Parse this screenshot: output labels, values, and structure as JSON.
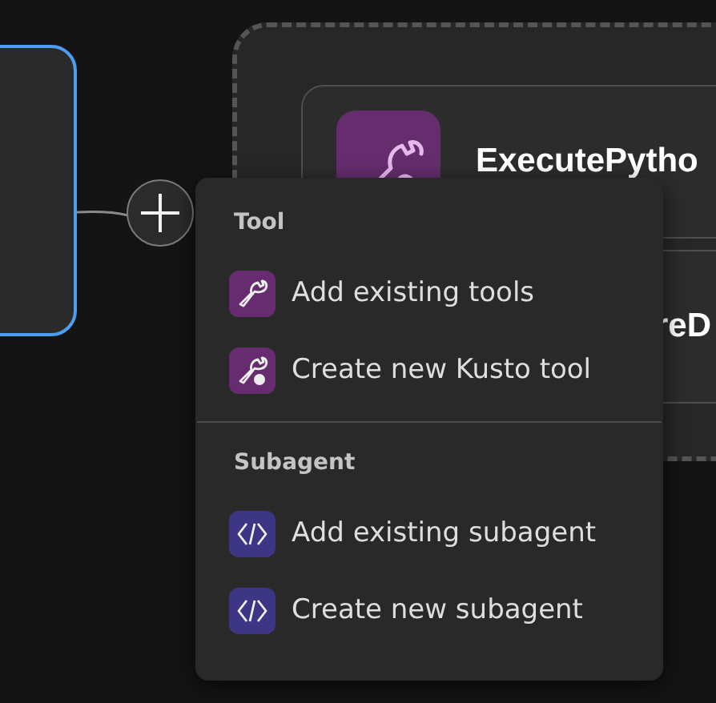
{
  "canvas": {
    "cards": [
      {
        "title": "ExecutePytho",
        "kind": "tool"
      },
      {
        "title": "reD",
        "kind": "covered"
      }
    ]
  },
  "menu": {
    "sections": [
      {
        "title": "Tool",
        "items": [
          {
            "label": "Add existing tools",
            "kind": "wrench"
          },
          {
            "label": "Create new Kusto tool",
            "kind": "wrench-gear"
          }
        ]
      },
      {
        "title": "Subagent",
        "items": [
          {
            "label": "Add existing subagent",
            "kind": "code"
          },
          {
            "label": "Create new subagent",
            "kind": "code"
          }
        ]
      }
    ]
  }
}
